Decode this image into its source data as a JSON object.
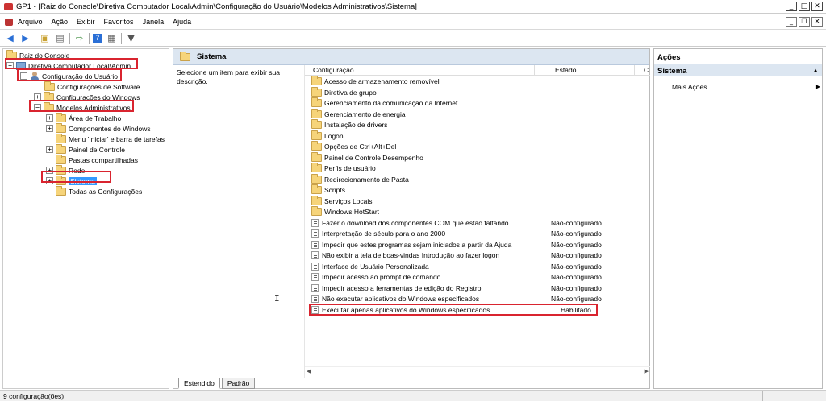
{
  "window": {
    "title": "GP1 - [Raiz do Console\\Diretiva Computador Local\\Admin\\Configuração do Usuário\\Modelos Administrativos\\Sistema]"
  },
  "menubar": {
    "items": [
      "Arquivo",
      "Ação",
      "Exibir",
      "Favoritos",
      "Janela",
      "Ajuda"
    ]
  },
  "tree": {
    "root": "Raiz do Console",
    "policy": "Diretiva Computador Local\\Admin",
    "user_config": "Configuração do Usuário",
    "software": "Configurações de Software",
    "windows": "Configurações do Windows",
    "admin_templates": "Modelos Administrativos",
    "desktop": "Área de Trabalho",
    "components": "Componentes do Windows",
    "startmenu": "Menu 'Iniciar' e barra de tarefas",
    "control_panel": "Painel de Controle",
    "shared": "Pastas compartilhadas",
    "network": "Rede",
    "system": "Sistema",
    "all": "Todas as Configurações"
  },
  "main": {
    "header": "Sistema",
    "description": "Selecione um item para exibir sua descrição.",
    "col_config": "Configuração",
    "col_state": "Estado",
    "col_c": "C",
    "folders": [
      "Acesso de armazenamento removível",
      "Diretiva de grupo",
      "Gerenciamento da comunicação da Internet",
      "Gerenciamento de energia",
      "Instalação de drivers",
      "Logon",
      "Opções de Ctrl+Alt+Del",
      "Painel de Controle Desempenho",
      "Perfis de usuário",
      "Redirecionamento de Pasta",
      "Scripts",
      "Serviços Locais",
      "Windows HotStart"
    ],
    "policies": [
      {
        "name": "Fazer o download dos componentes COM que estão faltando",
        "state": "Não-configurado"
      },
      {
        "name": "Interpretação de século para o ano 2000",
        "state": "Não-configurado"
      },
      {
        "name": "Impedir que estes programas sejam iniciados a partir da Ajuda",
        "state": "Não-configurado"
      },
      {
        "name": "Não exibir a tela de boas-vindas Introdução ao fazer logon",
        "state": "Não-configurado"
      },
      {
        "name": "Interface de Usuário Personalizada",
        "state": "Não-configurado"
      },
      {
        "name": "Impedir acesso ao prompt de comando",
        "state": "Não-configurado"
      },
      {
        "name": "Impedir acesso a ferramentas de edição do Registro",
        "state": "Não-configurado"
      },
      {
        "name": "Não executar aplicativos do Windows especificados",
        "state": "Não-configurado"
      },
      {
        "name": "Executar apenas aplicativos do Windows especificados",
        "state": "Habilitado"
      }
    ],
    "tabs": [
      "Estendido",
      "Padrão"
    ]
  },
  "actions": {
    "header": "Ações",
    "section": "Sistema",
    "more": "Mais Ações"
  },
  "status": {
    "text": "9 configuração(ões)"
  },
  "colors": {
    "highlight": "#d9242f",
    "header_bg": "#dce6f1",
    "selection": "#3399ff"
  }
}
